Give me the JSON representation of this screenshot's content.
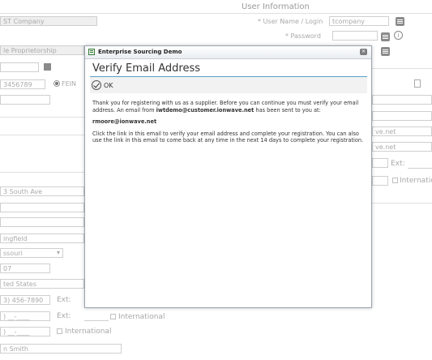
{
  "background": {
    "section_title": "User Information",
    "company_value": "ST Company",
    "structure_value": "le Proprietorship",
    "tax_id_value": "3456789",
    "fein_label": "FEIN",
    "address_value": "3 South Ave",
    "city_value": "ingfield",
    "state_value": "ssouri",
    "zip_value": "07",
    "country_value": "ted States",
    "phone_value": "3) 456-7890",
    "ext_label": "Ext:",
    "fax_value": ") __-____",
    "international_label": "International",
    "contact_value": "n Smith",
    "username_label": "* User Name / Login",
    "username_value": "tcompany",
    "password_label": "* Password",
    "email_fragment_1": "ve.net",
    "email_fragment_2": "ve.net",
    "right_ext_label": "Ext:",
    "right_international_label": "Internatio"
  },
  "dialog": {
    "window_title": "Enterprise Sourcing Demo",
    "heading": "Verify Email Address",
    "ok_label": "OK",
    "para1_before": "Thank you for registering with us as a supplier. Before you can continue you must verify your email address. An email from ",
    "para1_sender": "iwtdemo@customer.ionwave.net",
    "para1_after": " has been sent to you at:",
    "email": "rmoore@ionwave.net",
    "para3": "Click the link in this email to verify your email address and complete your registration. You can also use the link in this email to come back at any time in the next 14 days to complete your registration."
  }
}
